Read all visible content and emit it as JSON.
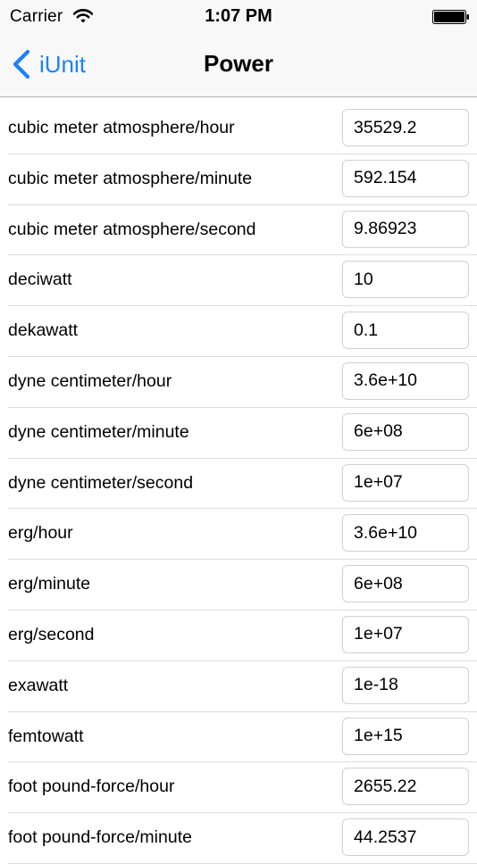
{
  "status_bar": {
    "carrier": "Carrier",
    "time": "1:07 PM"
  },
  "nav": {
    "back_label": "iUnit",
    "title": "Power",
    "tint": "#1a82fb"
  },
  "rows": [
    {
      "label": "cubic meter atmosphere/hour",
      "value": "35529.2"
    },
    {
      "label": "cubic meter atmosphere/minute",
      "value": "592.154"
    },
    {
      "label": "cubic meter atmosphere/second",
      "value": "9.86923"
    },
    {
      "label": "deciwatt",
      "value": "10"
    },
    {
      "label": "dekawatt",
      "value": "0.1"
    },
    {
      "label": "dyne centimeter/hour",
      "value": "3.6e+10"
    },
    {
      "label": "dyne centimeter/minute",
      "value": "6e+08"
    },
    {
      "label": "dyne centimeter/second",
      "value": "1e+07"
    },
    {
      "label": "erg/hour",
      "value": "3.6e+10"
    },
    {
      "label": "erg/minute",
      "value": "6e+08"
    },
    {
      "label": "erg/second",
      "value": "1e+07"
    },
    {
      "label": "exawatt",
      "value": "1e-18"
    },
    {
      "label": "femtowatt",
      "value": "1e+15"
    },
    {
      "label": "foot pound-force/hour",
      "value": "2655.22"
    },
    {
      "label": "foot pound-force/minute",
      "value": "44.2537"
    }
  ]
}
